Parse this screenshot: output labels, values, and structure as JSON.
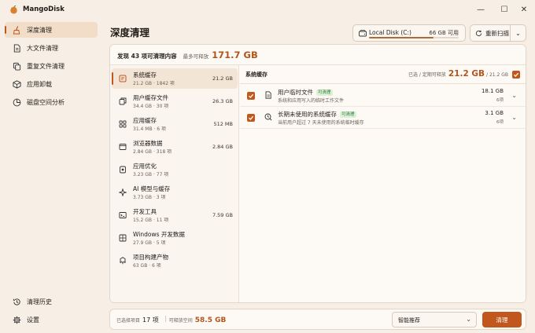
{
  "app": {
    "title": "MangoDisk"
  },
  "window_controls": {
    "minimize": "—",
    "maximize": "☐",
    "close": "✕"
  },
  "sidebar": {
    "items": [
      {
        "label": "深度清理",
        "active": true
      },
      {
        "label": "大文件清理"
      },
      {
        "label": "重复文件清理"
      },
      {
        "label": "应用卸载"
      },
      {
        "label": "磁盘空间分析"
      }
    ],
    "footer": [
      {
        "label": "清理历史"
      },
      {
        "label": "设置"
      }
    ]
  },
  "header": {
    "title": "深度清理",
    "disk": {
      "name": "Local Disk (C:)",
      "free": "66 GB 可用",
      "used_fraction": 0.72
    },
    "rescan_label": "重新扫描",
    "rescan_dropdown": "⌄"
  },
  "summary": {
    "found": "发现 43 项可清理内容",
    "cap_label": "最多可释放",
    "total": "171.7 GB"
  },
  "categories": [
    {
      "name": "系统缓存",
      "sub": "21.2 GB · 1842 项",
      "size": "21.2 GB",
      "active": true
    },
    {
      "name": "用户缓存文件",
      "sub": "34.4 GB · 30 项",
      "size": "26.3 GB"
    },
    {
      "name": "应用缓存",
      "sub": "31.4 MB · 6 项",
      "size": "512 MB"
    },
    {
      "name": "浏览器数据",
      "sub": "2.84 GB · 318 项",
      "size": "2.84 GB"
    },
    {
      "name": "应用优化",
      "sub": "3.23 GB · 77 项",
      "size": ""
    },
    {
      "name": "AI 模型与缓存",
      "sub": "3.73 GB · 3 项",
      "size": ""
    },
    {
      "name": "开发工具",
      "sub": "15.2 GB · 11 项",
      "size": "7.59 GB"
    },
    {
      "name": "Windows 开发数据",
      "sub": "27.9 GB · 5 项",
      "size": ""
    },
    {
      "name": "项目构建产物",
      "sub": "63 GB · 6 项",
      "size": ""
    }
  ],
  "detail": {
    "title": "系统缓存",
    "selected_label": "已选 / 定期可释放",
    "selected_value": "21.2 GB",
    "selected_total": "/ 21.2 GB",
    "rows": [
      {
        "name": "用户临时文件",
        "tag": "可清理",
        "desc": "系统和应用写入的临时工作文件",
        "size": "18.1 GB",
        "count": "6项"
      },
      {
        "name": "长期未使用的系统缓存",
        "tag": "可清理",
        "desc": "当前用户超过 7 天未使用的系统临时缓存",
        "size": "3.1 GB",
        "count": "6项"
      }
    ]
  },
  "bottom": {
    "selected_label": "已选择项目",
    "selected_count": "17 项",
    "reclaim_label": "可释放空间",
    "reclaim_value": "58.5 GB",
    "sort_label": "智能推荐",
    "sort_arrow": "⌄",
    "clean_label": "清理"
  },
  "colors": {
    "accent": "#c1571d",
    "accent_text": "#b2551d",
    "tag_green": "#2e7d3a"
  }
}
